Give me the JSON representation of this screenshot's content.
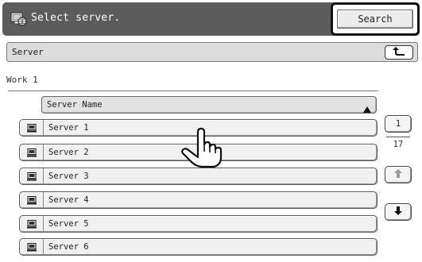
{
  "header": {
    "title": "Select server.",
    "search_label": "Search"
  },
  "path": {
    "label": "Server"
  },
  "work": {
    "label": "Work 1"
  },
  "list": {
    "column_header": "Server Name",
    "rows": [
      {
        "label": "Server 1"
      },
      {
        "label": "Server 2"
      },
      {
        "label": "Server 3"
      },
      {
        "label": "Server 4"
      },
      {
        "label": "Server 5"
      },
      {
        "label": "Server 6"
      }
    ]
  },
  "pager": {
    "current_page": "1",
    "total_pages": "17"
  },
  "icons": {
    "header": "server-globe-icon",
    "up": "up-folder-arrow-icon",
    "sort": "sort-ascending-icon",
    "row": "computer-icon",
    "scroll_up": "arrow-up-icon",
    "scroll_down": "arrow-down-icon",
    "cursor": "hand-pointer-icon"
  },
  "colors": {
    "header_bg": "#5c5c5c",
    "header_text": "#ffffff",
    "path_bg": "#dcdcdc",
    "row_bg": "#f0f0f0"
  }
}
